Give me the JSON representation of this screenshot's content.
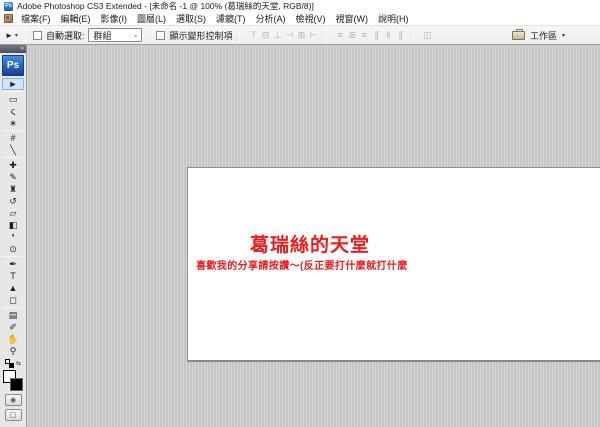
{
  "window": {
    "title": "Adobe Photoshop CS3 Extended - [未命名 -1 @ 100% (葛瑞絲的天堂, RGB/8)]",
    "app_icon_text": "Ps"
  },
  "menubar": {
    "items": [
      {
        "name": "file",
        "label": "檔案(F)"
      },
      {
        "name": "edit",
        "label": "編輯(E)"
      },
      {
        "name": "image",
        "label": "影像(I)"
      },
      {
        "name": "layer",
        "label": "圖層(L)"
      },
      {
        "name": "select",
        "label": "選取(S)"
      },
      {
        "name": "filter",
        "label": "濾鏡(T)"
      },
      {
        "name": "analysis",
        "label": "分析(A)"
      },
      {
        "name": "view",
        "label": "檢視(V)"
      },
      {
        "name": "window",
        "label": "視窗(W)"
      },
      {
        "name": "help",
        "label": "說明(H)"
      }
    ]
  },
  "options": {
    "move_icon_glyph": "►",
    "preset_caret": "▾",
    "auto_select_label": "自動選取:",
    "auto_select_value": "群組",
    "select_chevron": "⌄",
    "show_transform_label": "顯示變形控制項",
    "align_icons": [
      {
        "name": "align-top-edges",
        "glyph": "⊤"
      },
      {
        "name": "align-vertical-centers",
        "glyph": "⊟"
      },
      {
        "name": "align-bottom-edges",
        "glyph": "⊥"
      },
      {
        "name": "align-left-edges",
        "glyph": "⊣"
      },
      {
        "name": "align-horizontal-centers",
        "glyph": "⊞"
      },
      {
        "name": "align-right-edges",
        "glyph": "⊢"
      }
    ],
    "distribute_icons": [
      {
        "name": "distribute-top-edges",
        "glyph": "≡"
      },
      {
        "name": "distribute-vertical-centers",
        "glyph": "≣"
      },
      {
        "name": "distribute-bottom-edges",
        "glyph": "≡"
      },
      {
        "name": "distribute-left-edges",
        "glyph": "∥"
      },
      {
        "name": "distribute-horizontal-centers",
        "glyph": "‖"
      },
      {
        "name": "distribute-right-edges",
        "glyph": "∥"
      }
    ],
    "auto_align_icon": {
      "name": "auto-align-layers",
      "glyph": "◫"
    },
    "workspace_label": "工作區",
    "workspace_caret": "▾"
  },
  "toolbox": {
    "collapse_glyph": "»",
    "logo": "Ps",
    "tools": [
      {
        "name": "move",
        "glyph": "►",
        "selected": true
      },
      {
        "divider": true
      },
      {
        "name": "rectangular-marquee",
        "glyph": "▭"
      },
      {
        "name": "lasso",
        "glyph": "ς"
      },
      {
        "name": "magic-wand",
        "glyph": "∗"
      },
      {
        "divider": true
      },
      {
        "name": "crop",
        "glyph": "#"
      },
      {
        "name": "slice",
        "glyph": "╲"
      },
      {
        "divider": true
      },
      {
        "name": "spot-healing-brush",
        "glyph": "✚"
      },
      {
        "name": "brush",
        "glyph": "✎"
      },
      {
        "name": "clone-stamp",
        "glyph": "♜"
      },
      {
        "name": "history-brush",
        "glyph": "↺"
      },
      {
        "name": "eraser",
        "glyph": "▱"
      },
      {
        "name": "gradient",
        "glyph": "◧"
      },
      {
        "name": "blur",
        "glyph": "❛"
      },
      {
        "name": "dodge",
        "glyph": "⊙"
      },
      {
        "divider": true
      },
      {
        "name": "pen",
        "glyph": "✒"
      },
      {
        "name": "type",
        "glyph": "T"
      },
      {
        "name": "path-selection",
        "glyph": "▲"
      },
      {
        "name": "shape",
        "glyph": "◻"
      },
      {
        "divider": true
      },
      {
        "name": "notes",
        "glyph": "▤"
      },
      {
        "name": "eyedropper",
        "glyph": "✐"
      },
      {
        "name": "hand",
        "glyph": "✋"
      },
      {
        "name": "zoom",
        "glyph": "⚲"
      }
    ],
    "swap_glyph": "⇆",
    "quick_mask_glyph": "◉",
    "screen_mode_glyph": "▢",
    "foreground_color": "#ffffff",
    "background_color": "#000000"
  },
  "canvas": {
    "title": "葛瑞絲的天堂",
    "subtitle": "喜歡我的分享請按讚～(反正要打什麼就打什麼",
    "text_color": "#ee1b1b",
    "zoom_level": "100%",
    "document_name": "未命名 -1",
    "color_mode": "RGB/8"
  },
  "colors": {
    "workarea_gray": "#c9c9c9",
    "selected_tool_bg": "#cfe2f7",
    "accent_red": "#ee1b1b"
  }
}
